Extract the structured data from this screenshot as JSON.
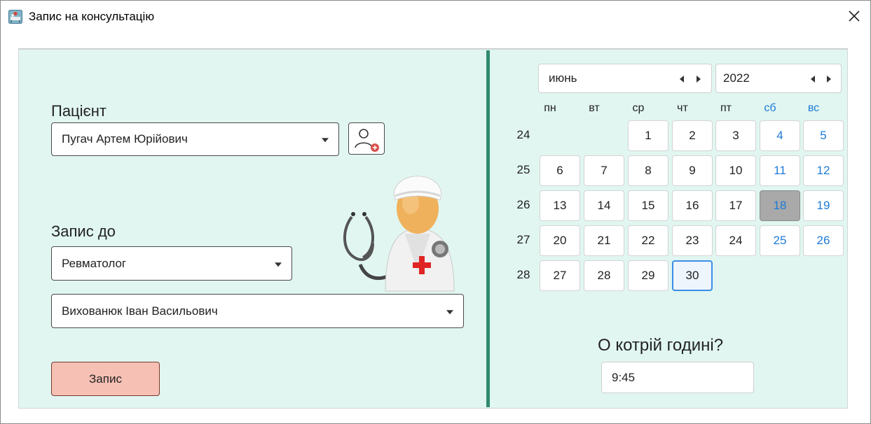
{
  "window": {
    "title": "Запис на консультацію"
  },
  "icons": [
    "app-icon",
    "close-icon",
    "add-patient-icon",
    "doctor-illustration"
  ],
  "patient": {
    "label": "Пацієнт",
    "value": "Пугач Артем Юрійович"
  },
  "appointment": {
    "label": "Запис до",
    "specialty": "Ревматолог",
    "doctor": "Вихованюк Іван Васильович"
  },
  "submit_label": "Запис",
  "calendar": {
    "month": "июнь",
    "year": "2022",
    "weekdays": [
      "пн",
      "вт",
      "ср",
      "чт",
      "пт",
      "сб",
      "вс"
    ],
    "week_numbers": [
      "24",
      "25",
      "26",
      "27",
      "28"
    ],
    "weeks": [
      [
        "",
        "",
        "1",
        "2",
        "3",
        "4",
        "5"
      ],
      [
        "6",
        "7",
        "8",
        "9",
        "10",
        "11",
        "12"
      ],
      [
        "13",
        "14",
        "15",
        "16",
        "17",
        "18",
        "19"
      ],
      [
        "20",
        "21",
        "22",
        "23",
        "24",
        "25",
        "26"
      ],
      [
        "27",
        "28",
        "29",
        "30",
        "",
        "",
        ""
      ]
    ],
    "selected_day": "18",
    "focused_day": "30"
  },
  "time": {
    "label": "О котрій годині?",
    "value": "9:45"
  },
  "colors": {
    "panel": "#e1f6f1",
    "divider": "#2f8a70",
    "weekend": "#1e7ad6",
    "button": "#f6c0b4"
  }
}
